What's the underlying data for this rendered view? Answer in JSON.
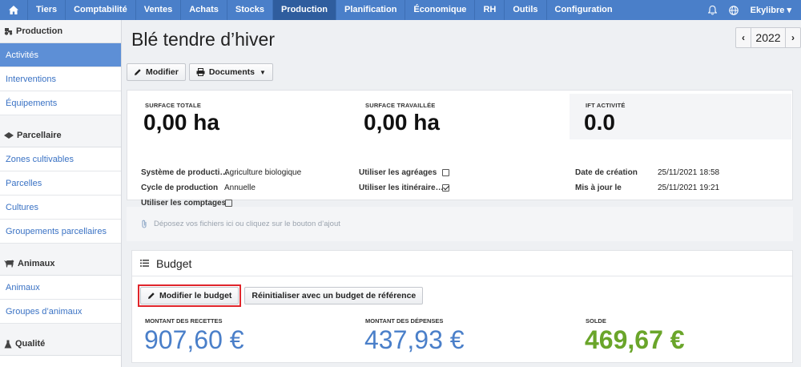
{
  "nav": {
    "items": [
      "Tiers",
      "Comptabilité",
      "Ventes",
      "Achats",
      "Stocks",
      "Production",
      "Planification",
      "Économique",
      "RH",
      "Outils",
      "Configuration"
    ],
    "active": "Production",
    "user": "Ekylibre"
  },
  "sidebar": {
    "sections": [
      {
        "title": "Production",
        "icon": "tractor-icon",
        "items": [
          "Activités",
          "Interventions",
          "Équipements"
        ]
      },
      {
        "title": "Parcellaire",
        "icon": "field-icon",
        "items": [
          "Zones cultivables",
          "Parcelles",
          "Cultures",
          "Groupements parcellaires"
        ]
      },
      {
        "title": "Animaux",
        "icon": "cow-icon",
        "items": [
          "Animaux",
          "Groupes d’animaux"
        ]
      },
      {
        "title": "Qualité",
        "icon": "flask-icon",
        "items": []
      }
    ],
    "active_item": "Activités"
  },
  "page": {
    "title": "Blé tendre d’hiver",
    "year": "2022"
  },
  "toolbar": {
    "edit_label": "Modifier",
    "documents_label": "Documents"
  },
  "metrics": {
    "surface_totale_label": "SURFACE TOTALE",
    "surface_totale_value": "0,00 ha",
    "surface_travaillee_label": "SURFACE TRAVAILLÉE",
    "surface_travaillee_value": "0,00 ha",
    "ift_label": "IFT ACTIVITÉ",
    "ift_value": "0.0"
  },
  "details": {
    "systeme_label": "Système de producti…",
    "systeme_value": "Agriculture biologique",
    "cycle_label": "Cycle de production",
    "cycle_value": "Annuelle",
    "comptages_label": "Utiliser les comptages",
    "comptages_checked": false,
    "agreages_label": "Utiliser les agréages",
    "agreages_checked": false,
    "itineraires_label": "Utiliser les itinéraire…",
    "itineraires_checked": true,
    "creation_label": "Date de création",
    "creation_value": "25/11/2021 18:58",
    "maj_label": "Mis à jour le",
    "maj_value": "25/11/2021 19:21"
  },
  "dropzone": {
    "text": "Déposez vos fichiers ici ou cliquez sur le bouton d’ajout"
  },
  "budget": {
    "title": "Budget",
    "edit_label": "Modifier le budget",
    "reset_label": "Réinitialiser avec un budget de référence",
    "recettes_label": "MONTANT DES RECETTES",
    "recettes_value": "907,60 €",
    "depenses_label": "MONTANT DES DÉPENSES",
    "depenses_value": "437,93 €",
    "solde_label": "SOLDE",
    "solde_value": "469,67 €",
    "colors": {
      "amount": "#4a7fc9",
      "balance": "#6aa52a"
    }
  }
}
